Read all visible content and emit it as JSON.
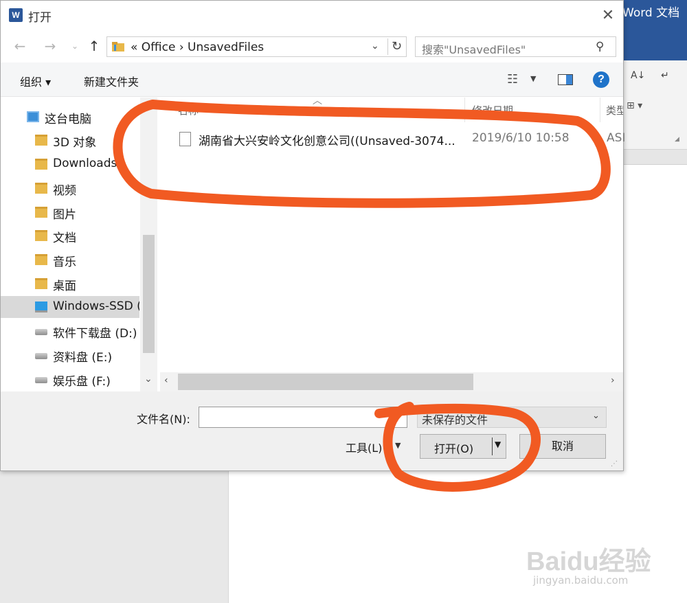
{
  "word": {
    "title": "Word 文档",
    "colors": {
      "brand": "#2b579a"
    }
  },
  "dialog": {
    "title": "打开",
    "app_icon": "W",
    "close_icon": "✕"
  },
  "address": {
    "breadcrumb": "«  Office  ›  UnsavedFiles",
    "search_placeholder": "搜索\"UnsavedFiles\""
  },
  "toolbar": {
    "organize": "组织 ▾",
    "new_folder": "新建文件夹"
  },
  "nav": {
    "items": [
      {
        "label": "这台电脑",
        "icon": "pc-icon"
      },
      {
        "label": "3D 对象",
        "icon": "folder-icon"
      },
      {
        "label": "Downloads",
        "icon": "folder-icon"
      },
      {
        "label": "视频",
        "icon": "folder-icon"
      },
      {
        "label": "图片",
        "icon": "folder-icon"
      },
      {
        "label": "文档",
        "icon": "folder-icon"
      },
      {
        "label": "音乐",
        "icon": "folder-icon"
      },
      {
        "label": "桌面",
        "icon": "folder-icon"
      },
      {
        "label": "Windows-SSD (",
        "icon": "windows-drive-icon"
      },
      {
        "label": "软件下载盘 (D:)",
        "icon": "drive-icon"
      },
      {
        "label": "资料盘 (E:)",
        "icon": "drive-icon"
      },
      {
        "label": "娱乐盘 (F:)",
        "icon": "drive-icon"
      }
    ],
    "selected_index": 8
  },
  "files": {
    "headers": {
      "name": "名称",
      "date": "修改日期",
      "type": "类型"
    },
    "rows": [
      {
        "name": "湖南省大兴安岭文化创意公司((Unsaved-3074...",
        "date": "2019/6/10 10:58",
        "type": "ASI"
      }
    ]
  },
  "bottom": {
    "filename_label": "文件名(N):",
    "filename_value": "",
    "filetype_value": "未保存的文件",
    "tools": "工具(L)",
    "open": "打开(O)",
    "cancel": "取消"
  },
  "watermark": {
    "main": "Bai",
    "mid": "du",
    "cn": "经验",
    "sub": "jingyan.baidu.com"
  },
  "colors": {
    "annotation": "#f15a22",
    "help": "#1f73c9",
    "selected_row": "#d9d9d9"
  }
}
